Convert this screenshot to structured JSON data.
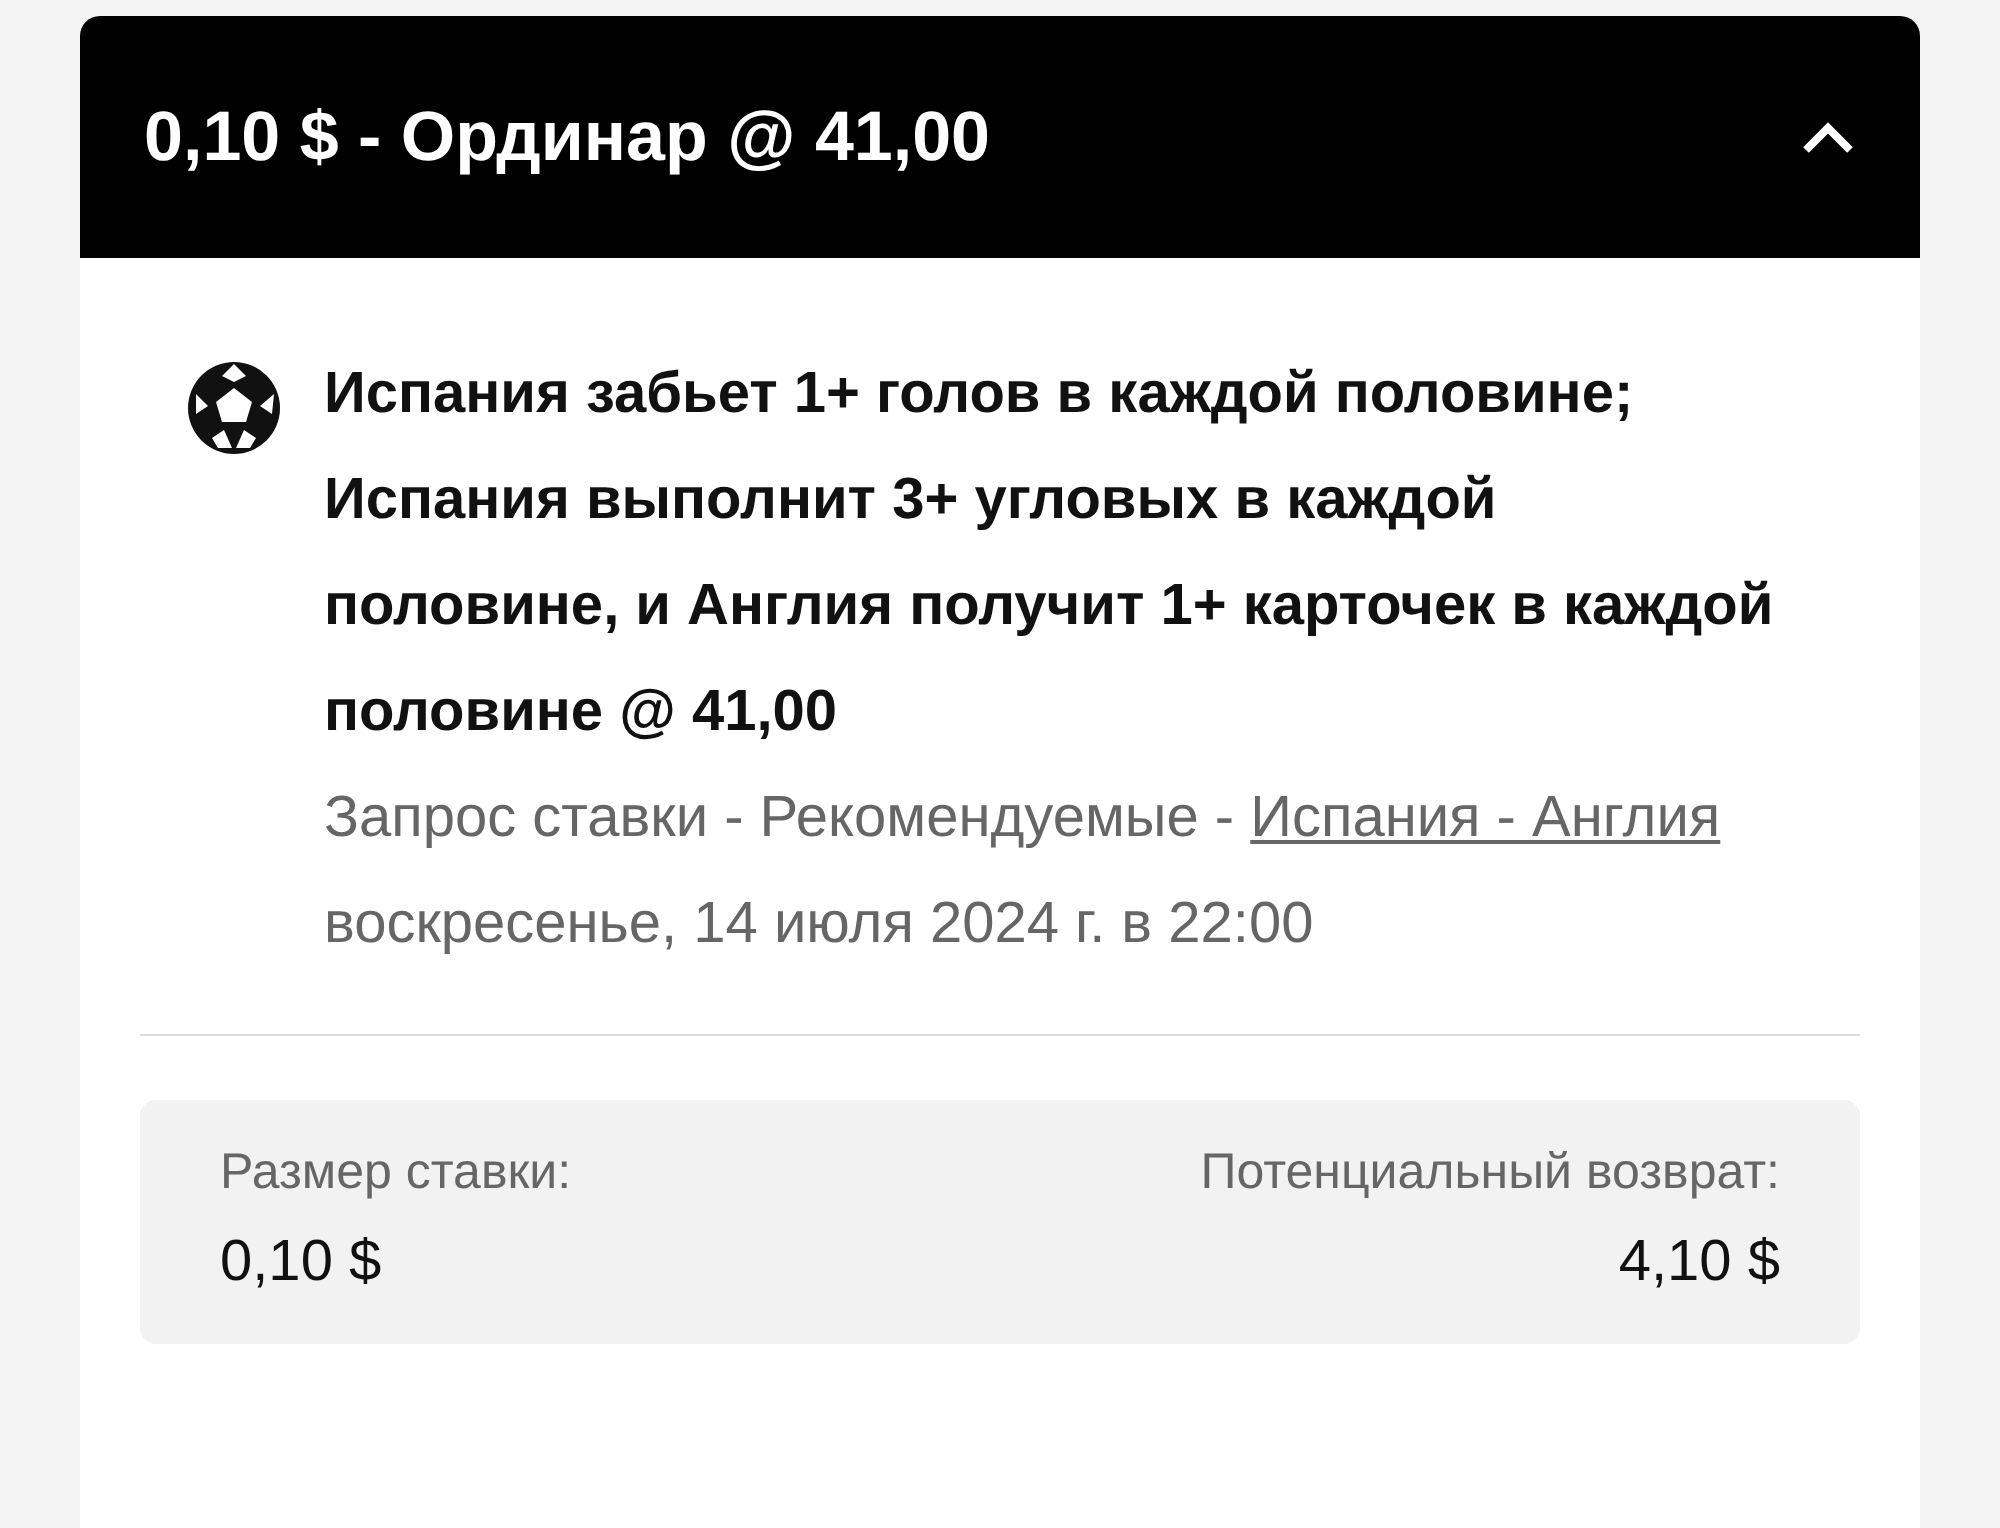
{
  "header": {
    "title": "0,10 $ - Ординар @ 41,00",
    "expanded": true
  },
  "bet": {
    "title": "Испания забьет 1+ голов в каждой половине; Испания выполнит 3+ угловых в каждой половине, и Англия получит 1+ карточек в каждой половине @ 41,00",
    "market": "Запрос ставки - Рекомендуемые - ",
    "event_link": "Испания - Англия",
    "date": "воскресенье, 14 июля 2024 г. в 22:00"
  },
  "summary": [
    {
      "label": "Размер ставки:",
      "value": "0,10 $"
    },
    {
      "label": "Потенциальный возврат:",
      "value": "4,10 $"
    }
  ]
}
